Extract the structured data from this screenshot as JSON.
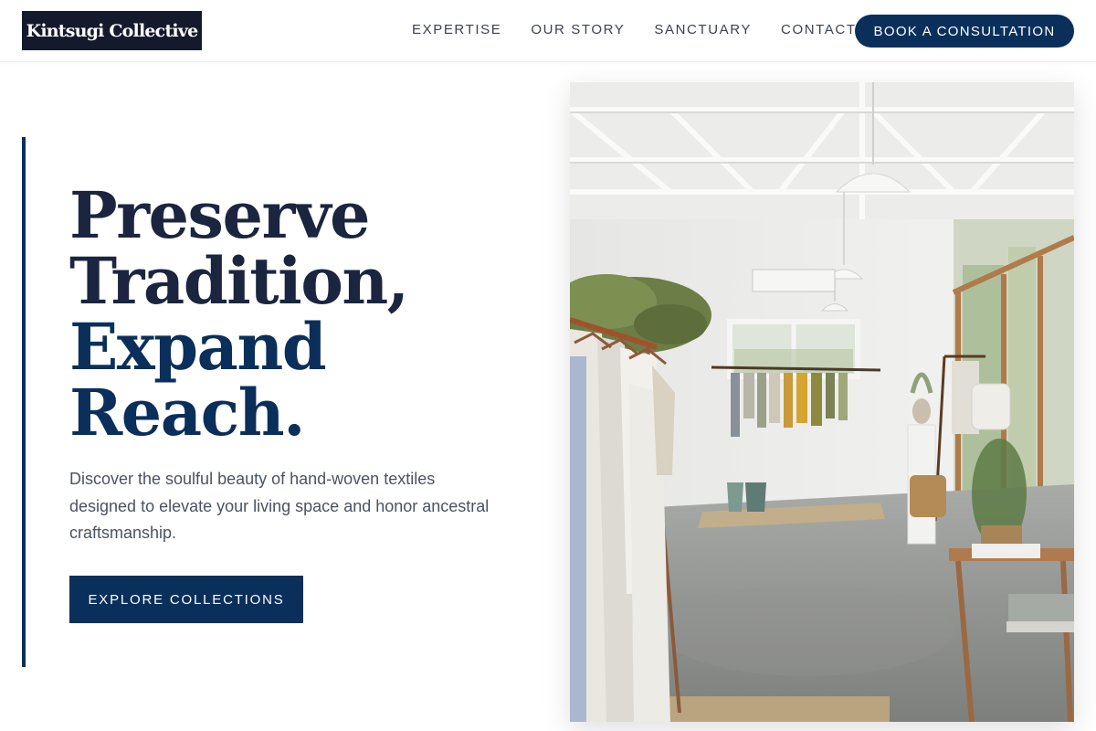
{
  "header": {
    "logo": "Kintsugi Collective",
    "nav": [
      "EXPERTISE",
      "OUR STORY",
      "SANCTUARY",
      "CONTACT"
    ],
    "cta": "BOOK A CONSULTATION"
  },
  "hero": {
    "headline_lines": [
      "Preserve",
      "Tradition,",
      "Expand",
      "Reach."
    ],
    "subtext": "Discover the soulful beauty of hand-woven textiles designed to elevate your living space and honor ancestral craftsmanship.",
    "button": "EXPLORE COLLECTIONS"
  },
  "image": {
    "subject": "boutique-interior-photo"
  },
  "colors": {
    "primary": "#0b2f5b",
    "logo_bg": "#141a2c",
    "text_dark": "#1b2540",
    "text_muted": "#4b5263"
  }
}
